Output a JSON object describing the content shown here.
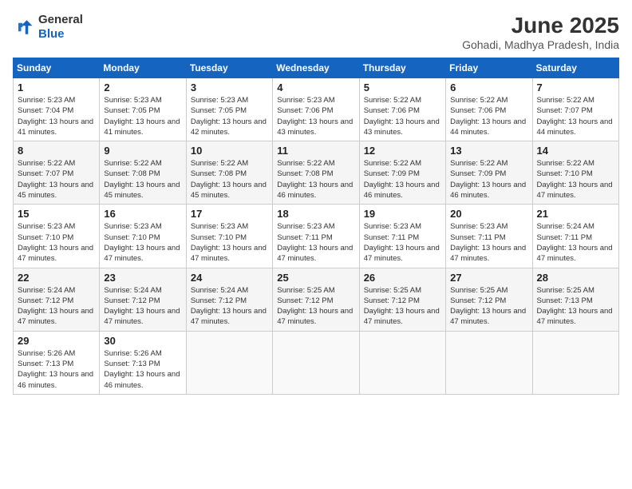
{
  "logo": {
    "line1": "General",
    "line2": "Blue"
  },
  "title": "June 2025",
  "subtitle": "Gohadi, Madhya Pradesh, India",
  "headers": [
    "Sunday",
    "Monday",
    "Tuesday",
    "Wednesday",
    "Thursday",
    "Friday",
    "Saturday"
  ],
  "weeks": [
    [
      {
        "day": "1",
        "sunrise": "5:23 AM",
        "sunset": "7:04 PM",
        "daylight": "13 hours and 41 minutes."
      },
      {
        "day": "2",
        "sunrise": "5:23 AM",
        "sunset": "7:05 PM",
        "daylight": "13 hours and 41 minutes."
      },
      {
        "day": "3",
        "sunrise": "5:23 AM",
        "sunset": "7:05 PM",
        "daylight": "13 hours and 42 minutes."
      },
      {
        "day": "4",
        "sunrise": "5:23 AM",
        "sunset": "7:06 PM",
        "daylight": "13 hours and 43 minutes."
      },
      {
        "day": "5",
        "sunrise": "5:22 AM",
        "sunset": "7:06 PM",
        "daylight": "13 hours and 43 minutes."
      },
      {
        "day": "6",
        "sunrise": "5:22 AM",
        "sunset": "7:06 PM",
        "daylight": "13 hours and 44 minutes."
      },
      {
        "day": "7",
        "sunrise": "5:22 AM",
        "sunset": "7:07 PM",
        "daylight": "13 hours and 44 minutes."
      }
    ],
    [
      {
        "day": "8",
        "sunrise": "5:22 AM",
        "sunset": "7:07 PM",
        "daylight": "13 hours and 45 minutes."
      },
      {
        "day": "9",
        "sunrise": "5:22 AM",
        "sunset": "7:08 PM",
        "daylight": "13 hours and 45 minutes."
      },
      {
        "day": "10",
        "sunrise": "5:22 AM",
        "sunset": "7:08 PM",
        "daylight": "13 hours and 45 minutes."
      },
      {
        "day": "11",
        "sunrise": "5:22 AM",
        "sunset": "7:08 PM",
        "daylight": "13 hours and 46 minutes."
      },
      {
        "day": "12",
        "sunrise": "5:22 AM",
        "sunset": "7:09 PM",
        "daylight": "13 hours and 46 minutes."
      },
      {
        "day": "13",
        "sunrise": "5:22 AM",
        "sunset": "7:09 PM",
        "daylight": "13 hours and 46 minutes."
      },
      {
        "day": "14",
        "sunrise": "5:22 AM",
        "sunset": "7:10 PM",
        "daylight": "13 hours and 47 minutes."
      }
    ],
    [
      {
        "day": "15",
        "sunrise": "5:23 AM",
        "sunset": "7:10 PM",
        "daylight": "13 hours and 47 minutes."
      },
      {
        "day": "16",
        "sunrise": "5:23 AM",
        "sunset": "7:10 PM",
        "daylight": "13 hours and 47 minutes."
      },
      {
        "day": "17",
        "sunrise": "5:23 AM",
        "sunset": "7:10 PM",
        "daylight": "13 hours and 47 minutes."
      },
      {
        "day": "18",
        "sunrise": "5:23 AM",
        "sunset": "7:11 PM",
        "daylight": "13 hours and 47 minutes."
      },
      {
        "day": "19",
        "sunrise": "5:23 AM",
        "sunset": "7:11 PM",
        "daylight": "13 hours and 47 minutes."
      },
      {
        "day": "20",
        "sunrise": "5:23 AM",
        "sunset": "7:11 PM",
        "daylight": "13 hours and 47 minutes."
      },
      {
        "day": "21",
        "sunrise": "5:24 AM",
        "sunset": "7:11 PM",
        "daylight": "13 hours and 47 minutes."
      }
    ],
    [
      {
        "day": "22",
        "sunrise": "5:24 AM",
        "sunset": "7:12 PM",
        "daylight": "13 hours and 47 minutes."
      },
      {
        "day": "23",
        "sunrise": "5:24 AM",
        "sunset": "7:12 PM",
        "daylight": "13 hours and 47 minutes."
      },
      {
        "day": "24",
        "sunrise": "5:24 AM",
        "sunset": "7:12 PM",
        "daylight": "13 hours and 47 minutes."
      },
      {
        "day": "25",
        "sunrise": "5:25 AM",
        "sunset": "7:12 PM",
        "daylight": "13 hours and 47 minutes."
      },
      {
        "day": "26",
        "sunrise": "5:25 AM",
        "sunset": "7:12 PM",
        "daylight": "13 hours and 47 minutes."
      },
      {
        "day": "27",
        "sunrise": "5:25 AM",
        "sunset": "7:12 PM",
        "daylight": "13 hours and 47 minutes."
      },
      {
        "day": "28",
        "sunrise": "5:25 AM",
        "sunset": "7:13 PM",
        "daylight": "13 hours and 47 minutes."
      }
    ],
    [
      {
        "day": "29",
        "sunrise": "5:26 AM",
        "sunset": "7:13 PM",
        "daylight": "13 hours and 46 minutes."
      },
      {
        "day": "30",
        "sunrise": "5:26 AM",
        "sunset": "7:13 PM",
        "daylight": "13 hours and 46 minutes."
      },
      null,
      null,
      null,
      null,
      null
    ]
  ],
  "labels": {
    "sunrise": "Sunrise:",
    "sunset": "Sunset:",
    "daylight": "Daylight:"
  }
}
